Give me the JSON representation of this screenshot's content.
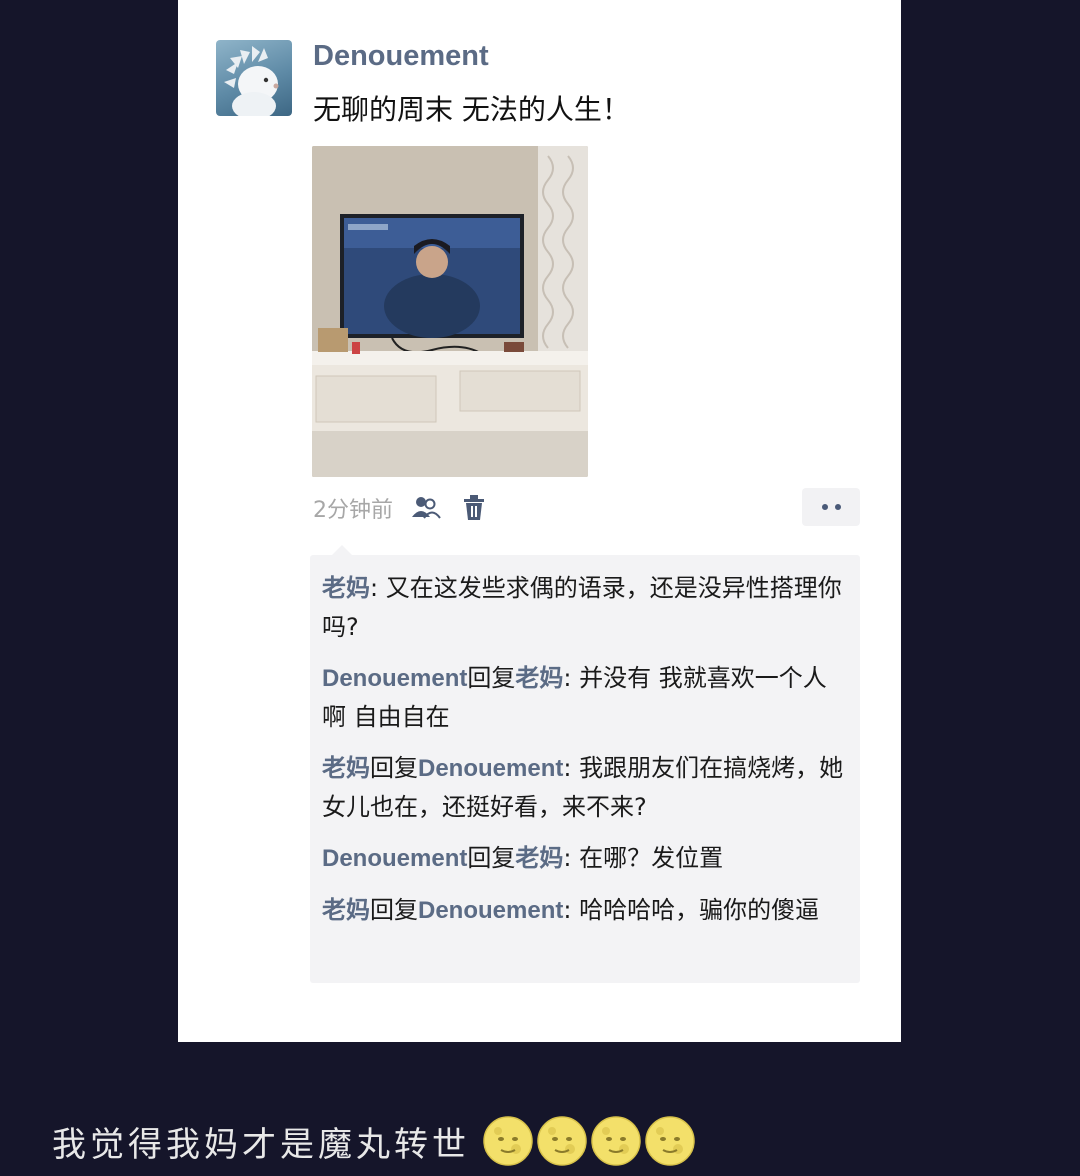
{
  "post": {
    "author": "Denouement",
    "text": "无聊的周末 无法的人生！",
    "timestamp": "2分钟前",
    "avatar_icon": "hedgehog-avatar",
    "photo_description_icon": "living-room-tv-photo"
  },
  "comments": [
    {
      "from": "老妈",
      "reply_label": "",
      "to": "",
      "sep": ": ",
      "text": "又在这发些求偶的语录，还是没异性搭理你吗?"
    },
    {
      "from": "Denouement",
      "reply_label": "回复",
      "to": "老妈",
      "sep": ": ",
      "text": "并没有 我就喜欢一个人啊 自由自在"
    },
    {
      "from": "老妈",
      "reply_label": "回复",
      "to": "Denouement",
      "sep": ": ",
      "text": "我跟朋友们在搞烧烤，她女儿也在，还挺好看，来不来?"
    },
    {
      "from": "Denouement",
      "reply_label": "回复",
      "to": "老妈",
      "sep": ": ",
      "text": "在哪？发位置"
    },
    {
      "from": "老妈",
      "reply_label": "回复",
      "to": "Denouement",
      "sep": ": ",
      "text": "哈哈哈哈，骗你的傻逼"
    }
  ],
  "caption": {
    "text": "我觉得我妈才是魔丸转世",
    "emoji": [
      "moon-face",
      "moon-face",
      "moon-face",
      "moon-face"
    ]
  },
  "colors": {
    "background": "#15152a",
    "nickname": "#5b6b85",
    "timestamp": "#a7a7a7",
    "comment_bg": "#f3f3f5"
  }
}
